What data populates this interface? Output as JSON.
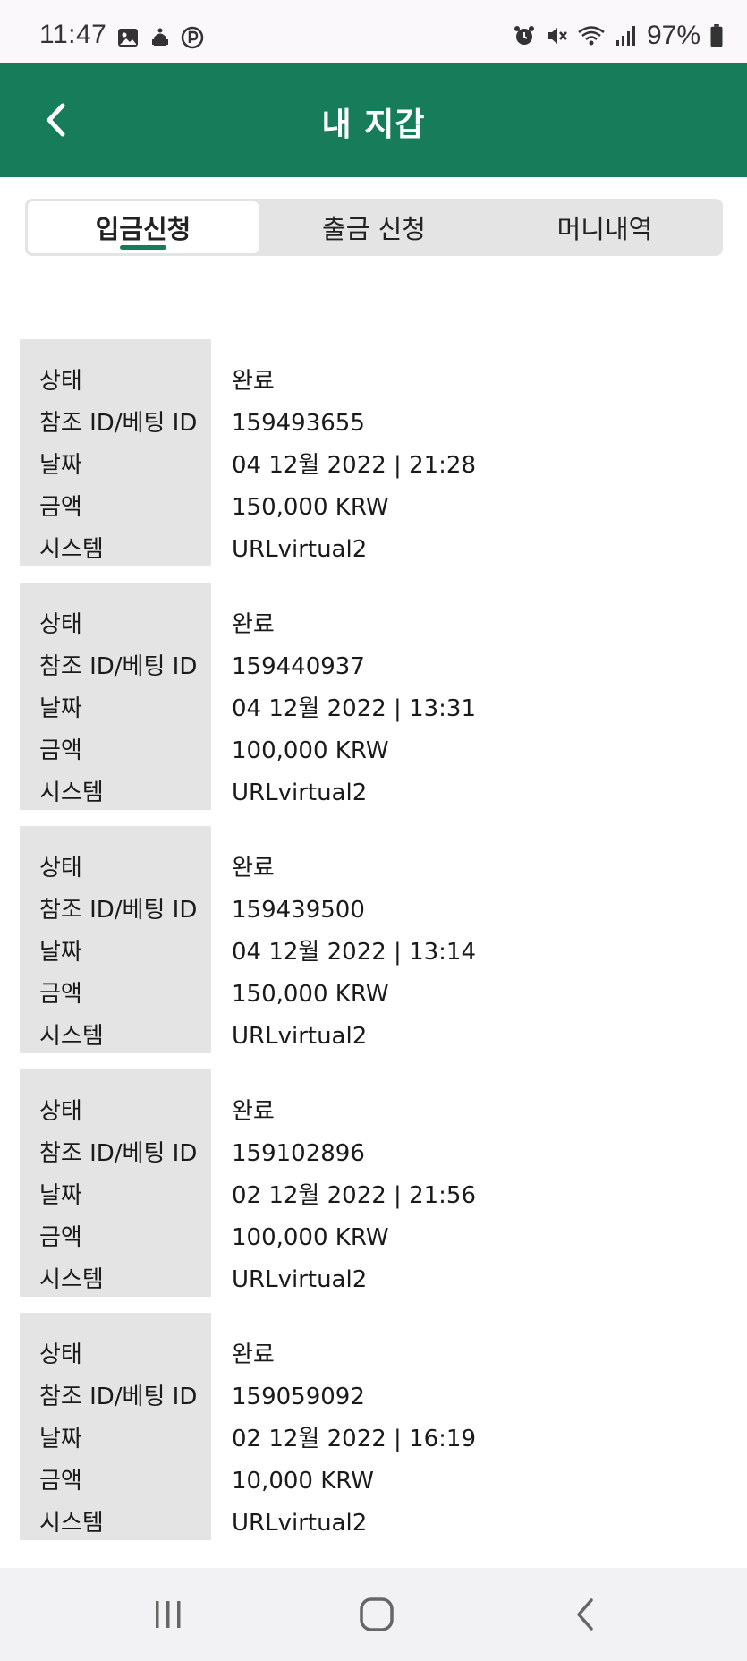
{
  "status_bar": {
    "time": "11:47",
    "battery": "97%",
    "left_icons": [
      "image-icon",
      "android-icon",
      "parking-icon"
    ],
    "right_icons": [
      "alarm-icon",
      "mute-icon",
      "wifi-icon",
      "signal-icon",
      "battery-icon"
    ]
  },
  "header": {
    "title": "내 지갑",
    "background": "#167c59"
  },
  "tabs": [
    {
      "label": "입금신청",
      "active": true
    },
    {
      "label": "출금 신청",
      "active": false
    },
    {
      "label": "머니내역",
      "active": false
    }
  ],
  "labels": {
    "status": "상태",
    "ref_id": "참조 ID/베팅 ID",
    "date": "날짜",
    "amount": "금액",
    "system": "시스템"
  },
  "records": [
    {
      "status": "완료",
      "ref_id": "159493655",
      "date": "04 12월 2022 | 21:28",
      "amount": "150,000 KRW",
      "system": "URLvirtual2"
    },
    {
      "status": "완료",
      "ref_id": "159440937",
      "date": "04 12월 2022 | 13:31",
      "amount": "100,000 KRW",
      "system": "URLvirtual2"
    },
    {
      "status": "완료",
      "ref_id": "159439500",
      "date": "04 12월 2022 | 13:14",
      "amount": "150,000 KRW",
      "system": "URLvirtual2"
    },
    {
      "status": "완료",
      "ref_id": "159102896",
      "date": "02 12월 2022 | 21:56",
      "amount": "100,000 KRW",
      "system": "URLvirtual2"
    },
    {
      "status": "완료",
      "ref_id": "159059092",
      "date": "02 12월 2022 | 16:19",
      "amount": "10,000 KRW",
      "system": "URLvirtual2"
    }
  ],
  "nav_bar": {
    "buttons": [
      "recent-apps-icon",
      "home-icon",
      "back-icon"
    ]
  }
}
